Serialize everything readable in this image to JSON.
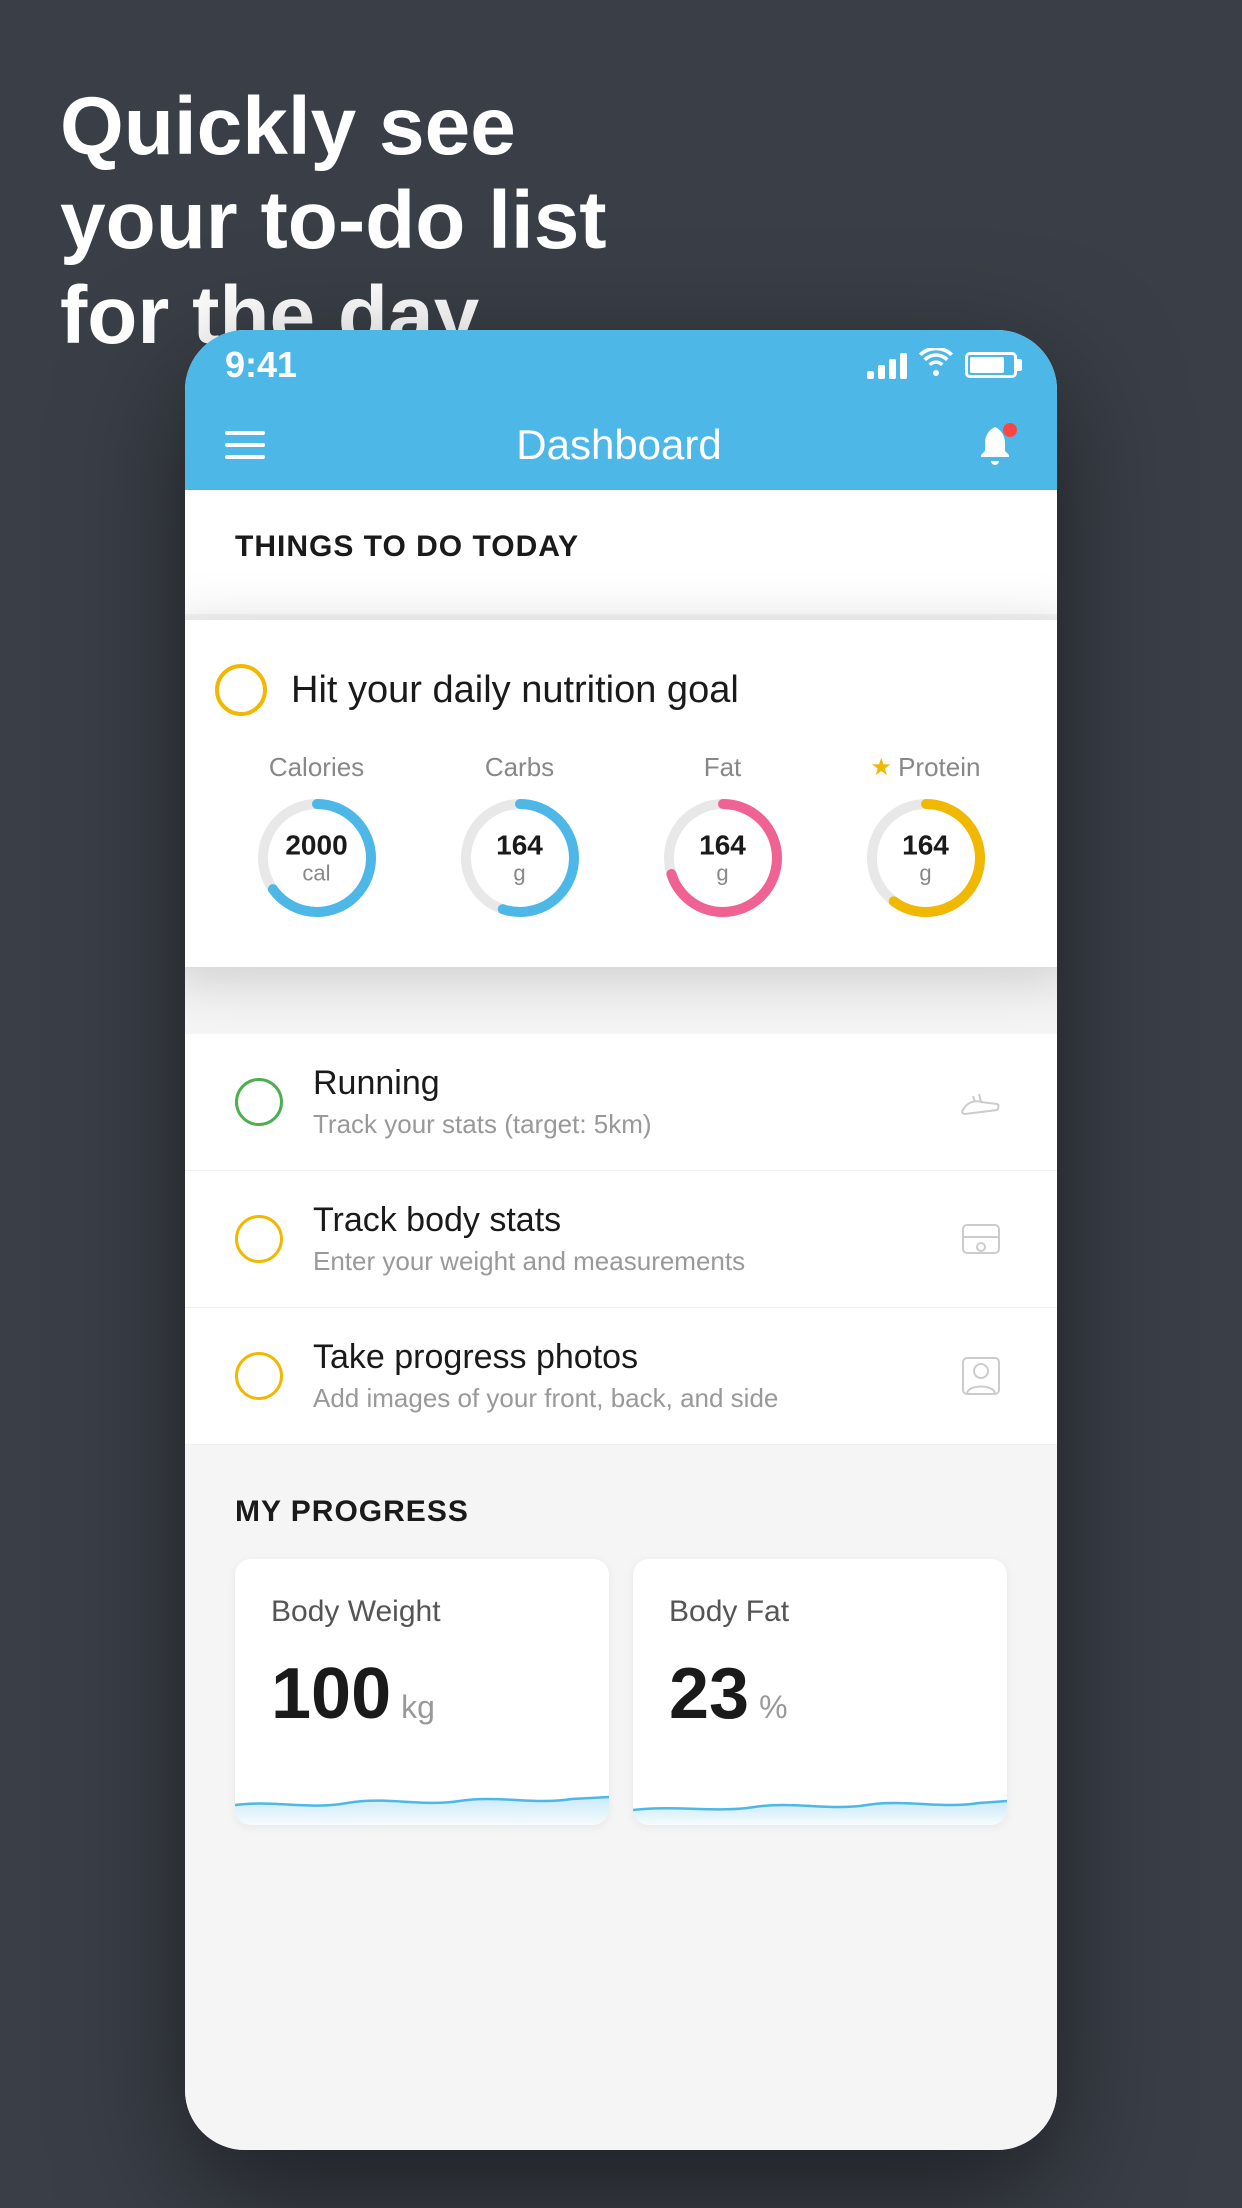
{
  "headline": {
    "line1": "Quickly see",
    "line2": "your to-do list",
    "line3": "for the day."
  },
  "status_bar": {
    "time": "9:41"
  },
  "nav": {
    "title": "Dashboard"
  },
  "things_section": {
    "title": "THINGS TO DO TODAY"
  },
  "floating_card": {
    "title": "Hit your daily nutrition goal",
    "nutrition": [
      {
        "label": "Calories",
        "value": "2000",
        "unit": "cal",
        "color": "#4db8e8",
        "percent": 65
      },
      {
        "label": "Carbs",
        "value": "164",
        "unit": "g",
        "color": "#4db8e8",
        "percent": 55
      },
      {
        "label": "Fat",
        "value": "164",
        "unit": "g",
        "color": "#f06292",
        "percent": 70
      },
      {
        "label": "Protein",
        "value": "164",
        "unit": "g",
        "color": "#f0b800",
        "percent": 60,
        "starred": true
      }
    ]
  },
  "todo_items": [
    {
      "name": "Running",
      "desc": "Track your stats (target: 5km)",
      "circle_color": "green",
      "icon": "shoe"
    },
    {
      "name": "Track body stats",
      "desc": "Enter your weight and measurements",
      "circle_color": "yellow",
      "icon": "scale"
    },
    {
      "name": "Take progress photos",
      "desc": "Add images of your front, back, and side",
      "circle_color": "yellow",
      "icon": "person"
    }
  ],
  "progress_section": {
    "title": "MY PROGRESS",
    "cards": [
      {
        "title": "Body Weight",
        "value": "100",
        "unit": "kg"
      },
      {
        "title": "Body Fat",
        "value": "23",
        "unit": "%"
      }
    ]
  }
}
